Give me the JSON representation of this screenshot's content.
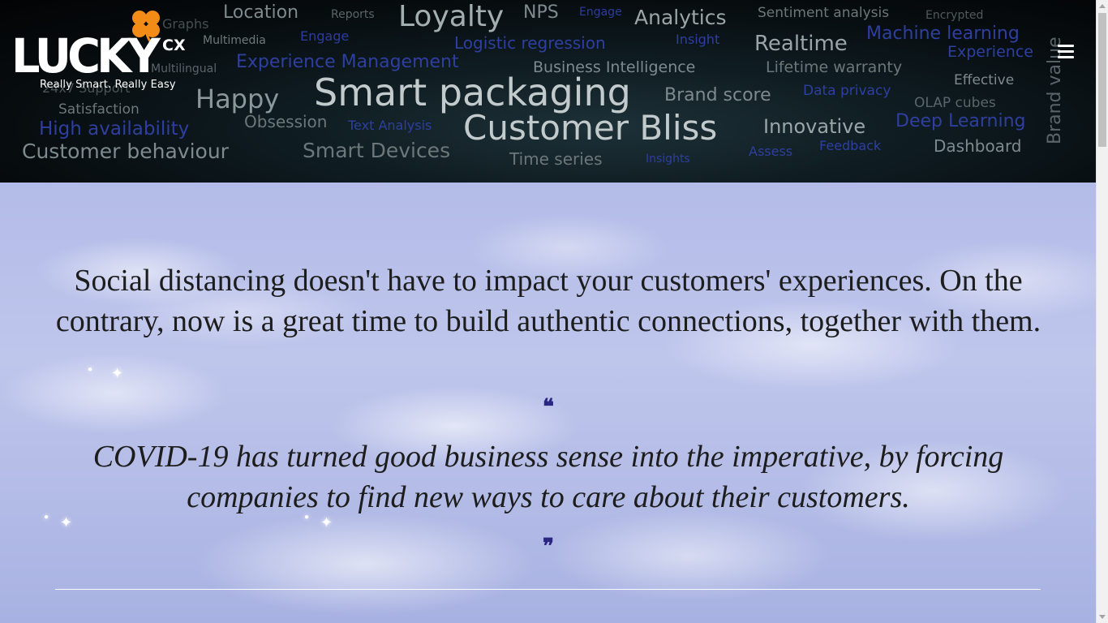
{
  "header": {
    "logo": {
      "word": "LUCKY",
      "suffix": "CX",
      "tagline": "Really Smart. Really Easy"
    },
    "menu_icon": "hamburger-menu-icon",
    "word_cloud": [
      {
        "text": "Location",
        "size": 22,
        "color": "#7d8a8e"
      },
      {
        "text": "Reports",
        "size": 14,
        "color": "#5a6569"
      },
      {
        "text": "Loyalty",
        "size": 36,
        "color": "#a3aeb1"
      },
      {
        "text": "NPS",
        "size": 22,
        "color": "#7d8a8e"
      },
      {
        "text": "Engage",
        "size": 14,
        "color": "#2d3d99"
      },
      {
        "text": "Analytics",
        "size": 25,
        "color": "#9aa5a8"
      },
      {
        "text": "Sentiment analysis",
        "size": 17,
        "color": "#6c7779"
      },
      {
        "text": "Encrypted",
        "size": 14,
        "color": "#505a5d"
      },
      {
        "text": "Graphs",
        "size": 16,
        "color": "#45504f"
      },
      {
        "text": "Multimedia",
        "size": 14,
        "color": "#6f797b"
      },
      {
        "text": "Engage",
        "size": 16,
        "color": "#2d3d99"
      },
      {
        "text": "Logistic regression",
        "size": 20,
        "color": "#2e3f9f"
      },
      {
        "text": "Insight",
        "size": 16,
        "color": "#2e3f9f"
      },
      {
        "text": "Realtime",
        "size": 26,
        "color": "#9aa5a8"
      },
      {
        "text": "Machine learning",
        "size": 22,
        "color": "#2e3f9f"
      },
      {
        "text": "Experience",
        "size": 19,
        "color": "#2e3f9f"
      },
      {
        "text": "Multilingual",
        "size": 14,
        "color": "#5a6569"
      },
      {
        "text": "Experience Management",
        "size": 22,
        "color": "#2e3f9f"
      },
      {
        "text": "Business Intelligence",
        "size": 19,
        "color": "#7d8a8e"
      },
      {
        "text": "Lifetime warranty",
        "size": 19,
        "color": "#6c7779"
      },
      {
        "text": "Effective",
        "size": 17,
        "color": "#7d8a8e"
      },
      {
        "text": "Brand value",
        "size": 22,
        "color": "#5a6569"
      },
      {
        "text": "24x7 Support",
        "size": 16,
        "color": "#4a5457"
      },
      {
        "text": "Happy",
        "size": 32,
        "color": "#8b989b"
      },
      {
        "text": "Smart packaging",
        "size": 46,
        "color": "#c2cacc"
      },
      {
        "text": "Brand score",
        "size": 22,
        "color": "#7d8a8e"
      },
      {
        "text": "Data privacy",
        "size": 17,
        "color": "#2e3f9f"
      },
      {
        "text": "OLAP cubes",
        "size": 17,
        "color": "#5a6569"
      },
      {
        "text": "Satisfaction",
        "size": 17,
        "color": "#6c7779"
      },
      {
        "text": "High availability",
        "size": 23,
        "color": "#2e3f9f"
      },
      {
        "text": "Obsession",
        "size": 20,
        "color": "#6c7779"
      },
      {
        "text": "Text Analysis",
        "size": 16,
        "color": "#2e3f9f"
      },
      {
        "text": "Customer Bliss",
        "size": 42,
        "color": "#c2cacc"
      },
      {
        "text": "Innovative",
        "size": 24,
        "color": "#9aa5a8"
      },
      {
        "text": "Deep Learning",
        "size": 22,
        "color": "#2e3f9f"
      },
      {
        "text": "Customer behaviour",
        "size": 25,
        "color": "#7d8a8e"
      },
      {
        "text": "Smart Devices",
        "size": 25,
        "color": "#6c7779"
      },
      {
        "text": "Time series",
        "size": 20,
        "color": "#6c7779"
      },
      {
        "text": "Insights",
        "size": 14,
        "color": "#2e3f9f"
      },
      {
        "text": "Assess",
        "size": 16,
        "color": "#2e3f9f"
      },
      {
        "text": "Feedback",
        "size": 16,
        "color": "#2e3f9f"
      },
      {
        "text": "Dashboard",
        "size": 20,
        "color": "#7d8a8e"
      }
    ]
  },
  "main": {
    "intro": "Social distancing doesn't have to impact your customers' experiences. On the contrary, now is a great time to build authentic connections, together with them.",
    "quote": {
      "open_mark": "❝",
      "text": "COVID-19 has turned good business sense into the imperative, by forcing companies to find new ways to care about their customers.",
      "close_mark": "❞"
    }
  },
  "colors": {
    "header_bg": "#0b1519",
    "sky_blue": "#b3bbe8",
    "quote_mark": "#2c2683",
    "clover_orange": "#f28c16",
    "body_text": "#1d1d1d"
  }
}
